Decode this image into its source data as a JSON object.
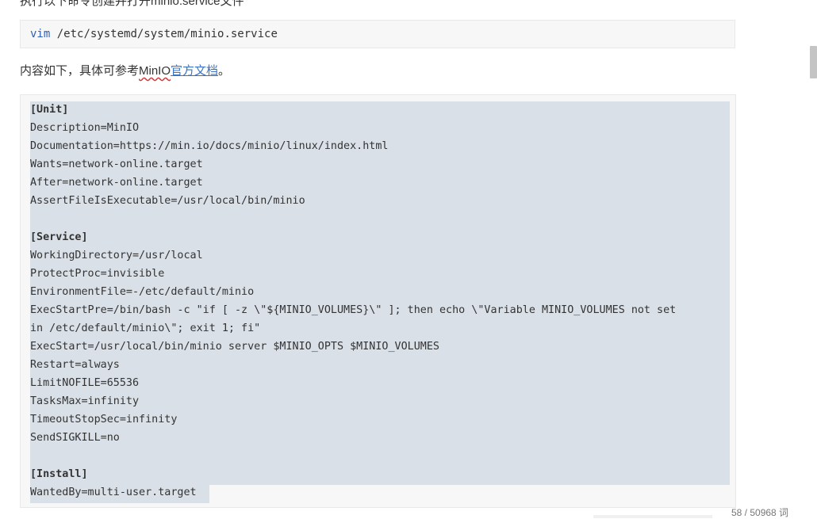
{
  "top_partial_text": "执行以下命令创建并打开minio.service文件",
  "command": {
    "keyword": "vim",
    "args": " /etc/systemd/system/minio.service"
  },
  "intro": {
    "before": "内容如下，具体可参考",
    "brand": "MinIO",
    "link": "官方文档",
    "after": "。"
  },
  "code_lines": [
    {
      "text": "[Unit]",
      "section": true
    },
    {
      "text": "Description=MinIO",
      "section": false
    },
    {
      "text": "Documentation=https://min.io/docs/minio/linux/index.html",
      "section": false
    },
    {
      "text": "Wants=network-online.target",
      "section": false
    },
    {
      "text": "After=network-online.target",
      "section": false
    },
    {
      "text": "AssertFileIsExecutable=/usr/local/bin/minio",
      "section": false
    },
    {
      "text": "",
      "section": false
    },
    {
      "text": "[Service]",
      "section": true
    },
    {
      "text": "WorkingDirectory=/usr/local",
      "section": false
    },
    {
      "text": "ProtectProc=invisible",
      "section": false
    },
    {
      "text": "EnvironmentFile=-/etc/default/minio",
      "section": false
    },
    {
      "text": "ExecStartPre=/bin/bash -c \"if [ -z \\\"${MINIO_VOLUMES}\\\" ]; then echo \\\"Variable MINIO_VOLUMES not set",
      "section": false
    },
    {
      "text": "in /etc/default/minio\\\"; exit 1; fi\"",
      "section": false
    },
    {
      "text": "ExecStart=/usr/local/bin/minio server $MINIO_OPTS $MINIO_VOLUMES",
      "section": false
    },
    {
      "text": "Restart=always",
      "section": false
    },
    {
      "text": "LimitNOFILE=65536",
      "section": false
    },
    {
      "text": "TasksMax=infinity",
      "section": false
    },
    {
      "text": "TimeoutStopSec=infinity",
      "section": false
    },
    {
      "text": "SendSIGKILL=no",
      "section": false
    },
    {
      "text": "",
      "section": false
    },
    {
      "text": "[Install]",
      "section": true
    },
    {
      "text": "WantedBy=multi-user.target",
      "section": false
    }
  ],
  "word_count": "58 / 50968 词"
}
